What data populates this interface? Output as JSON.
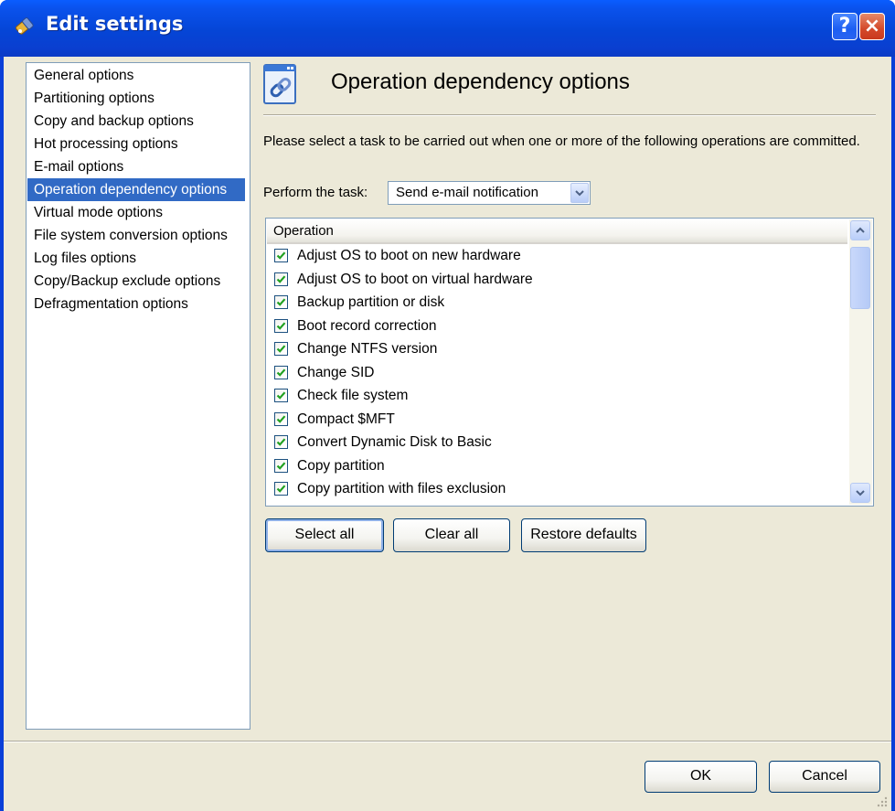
{
  "window": {
    "title": "Edit settings",
    "help_glyph": "?",
    "close_glyph": "×"
  },
  "sidebar": {
    "items": [
      {
        "label": "General options",
        "selected": false
      },
      {
        "label": "Partitioning options",
        "selected": false
      },
      {
        "label": "Copy and backup options",
        "selected": false
      },
      {
        "label": "Hot processing options",
        "selected": false
      },
      {
        "label": "E-mail options",
        "selected": false
      },
      {
        "label": "Operation dependency options",
        "selected": true
      },
      {
        "label": "Virtual mode options",
        "selected": false
      },
      {
        "label": "File system conversion options",
        "selected": false
      },
      {
        "label": "Log files options",
        "selected": false
      },
      {
        "label": "Copy/Backup exclude options",
        "selected": false
      },
      {
        "label": "Defragmentation options",
        "selected": false
      }
    ]
  },
  "panel": {
    "title": "Operation dependency options",
    "icon": "chain-link-window-icon",
    "description": "Please select a task to be carried out when one or more of the following operations are committed.",
    "perform_label": "Perform the task:",
    "task_select": {
      "value": "Send e-mail notification"
    }
  },
  "operations": {
    "header": "Operation",
    "rows": [
      {
        "label": "Adjust OS to boot on new hardware",
        "checked": true
      },
      {
        "label": "Adjust OS to boot on virtual hardware",
        "checked": true
      },
      {
        "label": "Backup partition or disk",
        "checked": true
      },
      {
        "label": "Boot record correction",
        "checked": true
      },
      {
        "label": "Change NTFS version",
        "checked": true
      },
      {
        "label": "Change SID",
        "checked": true
      },
      {
        "label": "Check file system",
        "checked": true
      },
      {
        "label": "Compact $MFT",
        "checked": true
      },
      {
        "label": "Convert Dynamic Disk to Basic",
        "checked": true
      },
      {
        "label": "Copy partition",
        "checked": true
      },
      {
        "label": "Copy partition with files exclusion",
        "checked": true
      }
    ]
  },
  "buttons": {
    "select_all": "Select all",
    "clear_all": "Clear all",
    "restore_defaults": "Restore defaults",
    "ok": "OK",
    "cancel": "Cancel"
  },
  "colors": {
    "selection": "#316ac5",
    "titlebar": "#0a4fe3",
    "dialog_bg": "#ece9d8",
    "checkmark": "#21a121"
  }
}
